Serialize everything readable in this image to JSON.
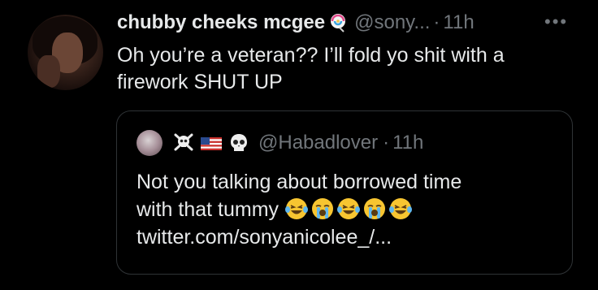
{
  "tweet": {
    "author_name": "chubby cheeks mcgee",
    "author_emoji": "lollipop-icon",
    "handle": "@sony...",
    "separator": "·",
    "time": "11h",
    "more": "•••",
    "text": "Oh you’re a veteran?? I’ll fold yo shit with a firework SHUT UP"
  },
  "quote": {
    "emojis": [
      "skull-crossbones-icon",
      "us-flag-icon",
      "skull-icon"
    ],
    "handle": "@Habadlover",
    "separator": "·",
    "time": "11h",
    "text_line1": "Not you talking about borrowed time",
    "text_line2": "with that tummy",
    "reactions": [
      "laughing-tears-icon",
      "crying-icon",
      "laughing-tears-icon",
      "crying-icon",
      "laughing-tears-icon"
    ],
    "link": "twitter.com/sonyanicolee_/..."
  }
}
